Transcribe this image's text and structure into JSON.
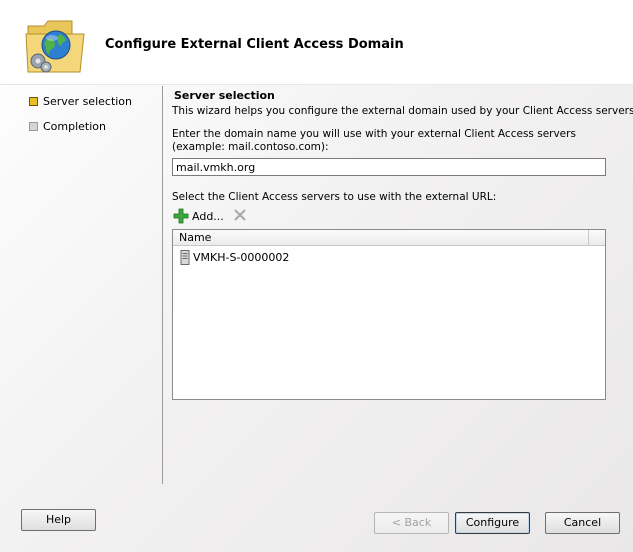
{
  "header": {
    "title": "Configure External Client Access Domain",
    "icon": "globe-folder-gear-icon"
  },
  "steps": [
    {
      "label": "Server selection",
      "state": "active"
    },
    {
      "label": "Completion",
      "state": "inactive"
    }
  ],
  "main": {
    "section_title": "Server selection",
    "description": "This wizard helps you configure the external domain used by your Client Access servers.",
    "domain_prompt": "Enter the domain name you will use with your external Client Access servers (example: mail.contoso.com):",
    "domain_value": "mail.vmkh.org",
    "servers_label": "Select the Client Access servers to use with the external URL:",
    "toolbar": {
      "add_label": "Add...",
      "add_icon": "green-plus-icon",
      "remove_icon": "remove-x-icon"
    },
    "server_list": {
      "columns": [
        "Name"
      ],
      "rows": [
        {
          "name": "VMKH-S-0000002",
          "icon": "server-icon"
        }
      ]
    }
  },
  "buttons": {
    "help": "Help",
    "back": "< Back",
    "configure": "Configure",
    "cancel": "Cancel"
  },
  "colors": {
    "active_step": "#e8c022",
    "inactive_step": "#d6d6d6",
    "add_icon": "#2e9a2e"
  }
}
